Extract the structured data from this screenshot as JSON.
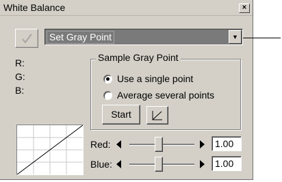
{
  "window": {
    "title": "White Balance",
    "close_glyph": "×"
  },
  "mode_select": {
    "value": "Set Gray Point",
    "arrow_glyph": "▼"
  },
  "readout": {
    "r_label": "R:",
    "g_label": "G:",
    "b_label": "B:"
  },
  "sample_group": {
    "title": "Sample Gray Point",
    "options": [
      {
        "label": "Use a single point",
        "selected": true
      },
      {
        "label": "Average several points",
        "selected": false
      }
    ],
    "start_label": "Start"
  },
  "sliders": [
    {
      "label": "Red:",
      "value": "1.00",
      "position": 0.45
    },
    {
      "label": "Blue:",
      "value": "1.00",
      "position": 0.45
    }
  ],
  "icons": {
    "confirm": "checkmark-icon",
    "curve": "curve-icon",
    "close": "close-icon"
  }
}
